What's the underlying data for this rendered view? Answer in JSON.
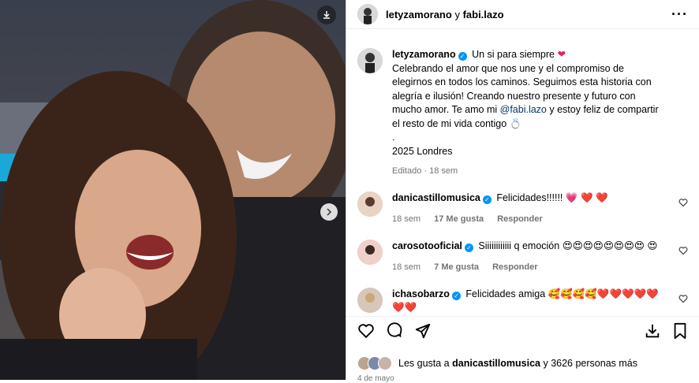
{
  "header": {
    "user": "letyzamorano",
    "joiner": "y",
    "coauthor": "fabi.lazo",
    "more_icon": "more-horizontal-icon"
  },
  "caption": {
    "user": "letyzamorano",
    "title": "Un si para siempre",
    "line1": "Celebrando el amor que nos une y el compromiso de elegirnos en todos los caminos. Seguimos esta historia con alegría e ilusión! Creando nuestro presente y futuro con mucho amor. Te amo mi",
    "mention": "@fabi.lazo",
    "line2": "y estoy feliz de compartir el resto de mi vida contigo",
    "dot": ".",
    "place": "2025 Londres",
    "edited": "Editado · 18 sem"
  },
  "comments": [
    {
      "user": "danicastillomusica",
      "text": "Felicidades!!!!!!",
      "emoji": "💗 ❤️ ❤️",
      "time": "18 sem",
      "likes": "17 Me gusta",
      "reply": "Responder"
    },
    {
      "user": "carosotooficial",
      "text": "Siiiiiiiiiiii q emoción",
      "emoji": "😍😍😍😍😍😍😍😍 😍",
      "time": "18 sem",
      "likes": "7 Me gusta",
      "reply": "Responder"
    },
    {
      "user": "ichasobarzo",
      "text": "Felicidades amiga",
      "emoji": "🥰🥰🥰🥰❤️❤️❤️❤️❤️ ❤️❤️",
      "time": "",
      "likes": "",
      "reply": ""
    }
  ],
  "likes": {
    "prefix": "Les gusta a",
    "user": "danicastillomusica",
    "suffix": "y 3626 personas más"
  },
  "date": "4 de mayo",
  "colors": {
    "verified": "#0095f6",
    "mention": "#00376b",
    "heart": "#e0245e"
  }
}
